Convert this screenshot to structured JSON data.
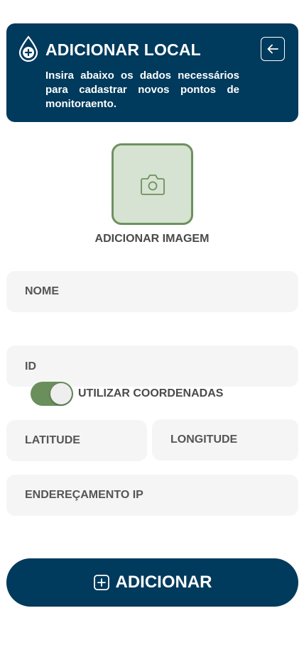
{
  "colors": {
    "primary": "#003a5c",
    "accent_green": "#6a8f5c",
    "field_bg": "#f5f5f5",
    "image_box_bg": "#d6e2d2"
  },
  "header": {
    "title": "ADICIONAR LOCAL",
    "description": "Insira abaixo os dados necessários para cadastrar novos pontos de monitoraento.",
    "logo_icon": "water-drop-plus-icon",
    "back_icon": "arrow-left-icon"
  },
  "image_picker": {
    "icon": "camera-icon",
    "label": "ADICIONAR IMAGEM"
  },
  "form": {
    "name_placeholder": "NOME",
    "id_placeholder": "ID",
    "use_coordinates_label": "UTILIZAR COORDENADAS",
    "use_coordinates_on": true,
    "latitude_placeholder": "LATITUDE",
    "longitude_placeholder": "LONGITUDE",
    "ip_placeholder": "ENDEREÇAMENTO IP"
  },
  "submit": {
    "icon": "plus-square-icon",
    "label": "ADICIONAR"
  }
}
